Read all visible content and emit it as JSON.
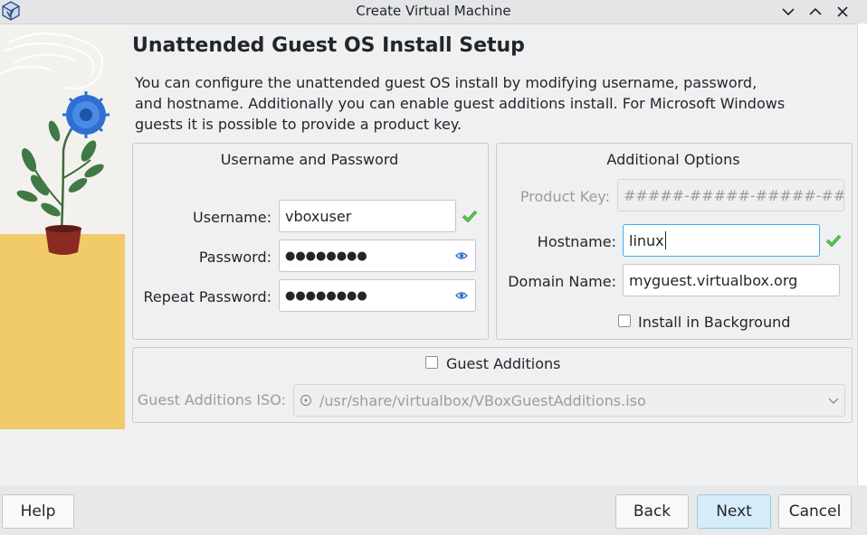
{
  "window": {
    "title": "Create Virtual Machine"
  },
  "page": {
    "heading": "Unattended Guest OS Install Setup",
    "description": "You can configure the unattended guest OS install by modifying username, password, and hostname. Additionally you can enable guest additions install. For Microsoft Windows guests it is possible to provide a product key."
  },
  "credentials": {
    "title": "Username and Password",
    "username_label": "Username:",
    "username_value": "vboxuser",
    "password_label": "Password:",
    "password_value": "●●●●●●●●",
    "repeat_label": "Repeat Password:",
    "repeat_value": "●●●●●●●●"
  },
  "options": {
    "title": "Additional Options",
    "product_key_label": "Product Key:",
    "product_key_placeholder": "#####-#####-#####-#####-",
    "hostname_label": "Hostname:",
    "hostname_value": "linux",
    "domain_label": "Domain Name:",
    "domain_value": "myguest.virtualbox.org",
    "install_bg_label": "Install in Background",
    "install_bg_checked": false
  },
  "guest_additions": {
    "checkbox_label": "Guest Additions",
    "checked": false,
    "iso_label": "Guest Additions ISO:",
    "iso_value": "/usr/share/virtualbox/VBoxGuestAdditions.iso"
  },
  "buttons": {
    "help": "Help",
    "back": "Back",
    "next": "Next",
    "cancel": "Cancel"
  },
  "colors": {
    "accent": "#3daee9",
    "valid_check": "#2ea32e",
    "illustration_sand": "#f1ca6a"
  }
}
